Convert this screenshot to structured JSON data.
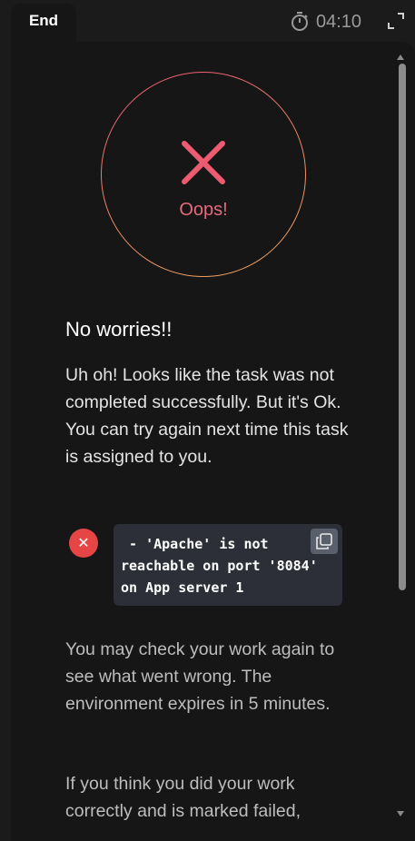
{
  "header": {
    "end_tab_label": "End",
    "timer_value": "04:10",
    "timer_icon": "stopwatch-icon",
    "expand_icon": "expand-icon"
  },
  "result": {
    "status_label": "Oops!",
    "status_icon": "x-mark-icon",
    "ring_colors": [
      "#e8587a",
      "#f2a85a"
    ],
    "title": "No worries!!",
    "message": "Uh oh! Looks like the task was not completed successfully. But it's Ok. You can try again next time this task is assigned to you."
  },
  "error": {
    "icon": "error-circle-icon",
    "icon_color": "#e54545",
    "code": " - 'Apache' is not reachable on port '8084' on App server 1",
    "copy_icon": "copy-icon"
  },
  "footer": {
    "note1": "You may check your work again to see what went wrong. The environment expires in 5 minutes.",
    "note2": "If you think you did your work correctly and is marked failed,"
  }
}
